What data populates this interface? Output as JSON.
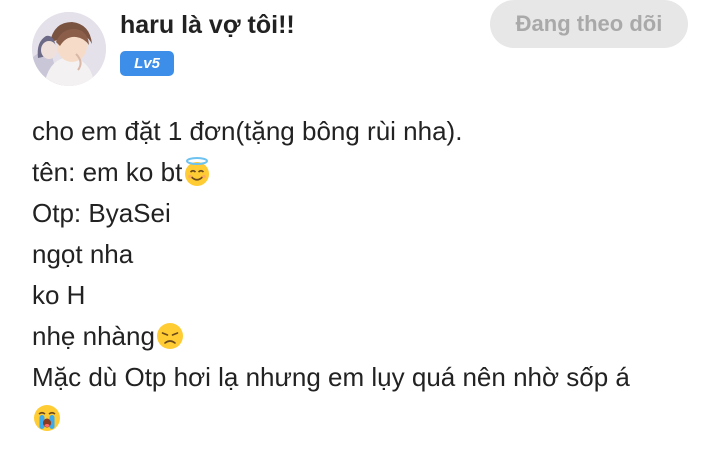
{
  "author": {
    "username": "haru là vợ tôi!!",
    "level": "Lv5",
    "avatar_icon": "anime-avatar-icon"
  },
  "follow_button": {
    "label": "Đang theo dõi"
  },
  "post": {
    "lines": [
      {
        "text": "cho em đặt 1 đơn(tặng bông rùi nha).",
        "emoji": null
      },
      {
        "text": "tên: em ko bt",
        "emoji": "smiling-face-with-halo-icon"
      },
      {
        "text": "Otp: ByaSei",
        "emoji": null
      },
      {
        "text": "ngọt nha",
        "emoji": null
      },
      {
        "text": "ko H",
        "emoji": null
      },
      {
        "text": "nhẹ nhàng",
        "emoji": "disappointed-face-icon"
      },
      {
        "text": "Mặc dù Otp hơi lạ nhưng em lụy quá nên nhờ sốp á",
        "emoji": null
      },
      {
        "text": "",
        "emoji": "loudly-crying-face-icon"
      }
    ]
  },
  "colors": {
    "badge": "#3d8ee8",
    "button_bg": "#e7e7e7",
    "button_text": "#a9a9a9",
    "text": "#222222",
    "emoji_yellow": "#ffcc33",
    "emoji_tears": "#3aa9ee"
  }
}
